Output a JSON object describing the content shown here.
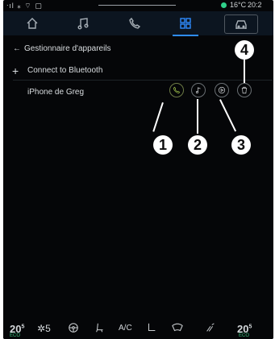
{
  "status_bar": {
    "temperature": "16°C",
    "time": "20:2"
  },
  "nav": {
    "items": [
      {
        "icon": "home-icon"
      },
      {
        "icon": "music-icon"
      },
      {
        "icon": "phone-icon"
      },
      {
        "icon": "apps-grid-icon",
        "active": true
      },
      {
        "icon": "car-icon"
      }
    ],
    "accent": "#2e8cff"
  },
  "page": {
    "title": "Gestionnaire d'appareils",
    "connect_label": "Connect to Bluetooth",
    "device_name": "iPhone de Greg"
  },
  "device_icons": [
    "phone-icon",
    "music-note-icon",
    "play-icon",
    "trash-icon"
  ],
  "callouts": [
    "1",
    "2",
    "3",
    "4"
  ],
  "bottom_bar": {
    "left_temp": "20",
    "left_unit": "5",
    "fan_speed": "5",
    "ac_label": "A/C",
    "right_temp": "20",
    "right_unit": "5",
    "eco_label": "ECO"
  }
}
